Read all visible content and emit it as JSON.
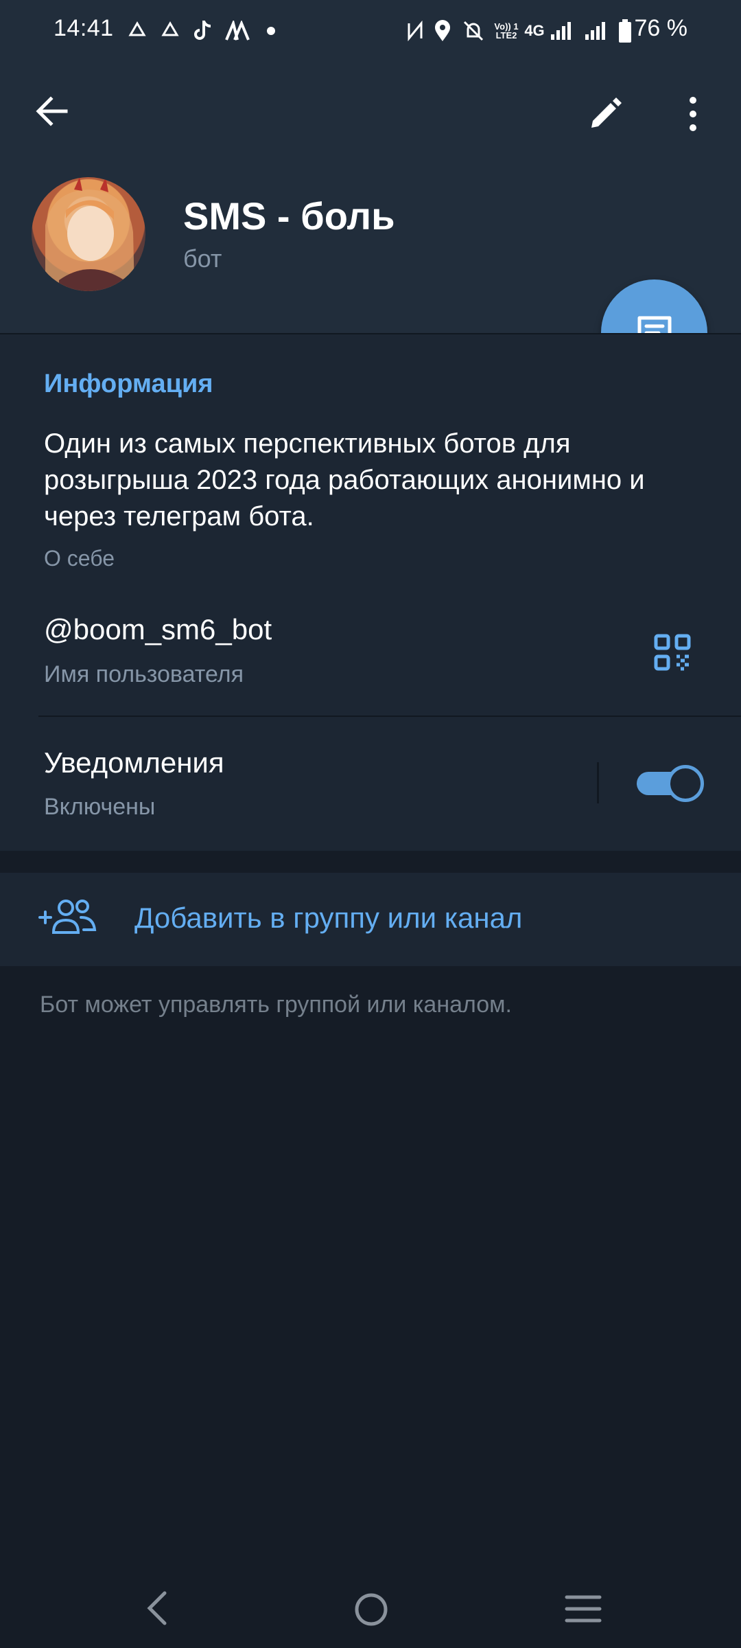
{
  "status_bar": {
    "time": "14:41",
    "battery": "76 %",
    "notification_icons": [
      "sync-icon",
      "sync-icon",
      "tiktok-icon",
      "app-icon",
      "dot-icon"
    ],
    "system_icons": [
      "nfc-icon",
      "location-icon",
      "mute-icon",
      "volte-icon",
      "4g-icon",
      "signal-icon",
      "signal-icon",
      "battery-icon"
    ],
    "volte_label": "Vo)) 1\nLTE2",
    "network_label": "4G"
  },
  "header": {
    "name": "SMS - боль",
    "status": "бот",
    "icons": {
      "back": "arrow-left-icon",
      "edit": "pencil-icon",
      "more": "more-vertical-icon",
      "fab": "message-icon"
    }
  },
  "info": {
    "title": "Информация",
    "bio": "Один из самых перспективных ботов для розыгрыша 2023 года работающих анонимно и через телеграм бота.",
    "bio_label": "О себе",
    "username": "@boom_sm6_bot",
    "username_label": "Имя пользователя",
    "notifications_title": "Уведомления",
    "notifications_value": "Включены",
    "notifications_enabled": true
  },
  "add_group": {
    "label": "Добавить в группу или канал",
    "hint": "Бот может управлять группой или каналом."
  },
  "colors": {
    "accent": "#64aef2",
    "header_bg": "#212d3b",
    "section_bg": "#1c2633",
    "page_bg": "#151c26",
    "fab": "#5b9edc"
  }
}
